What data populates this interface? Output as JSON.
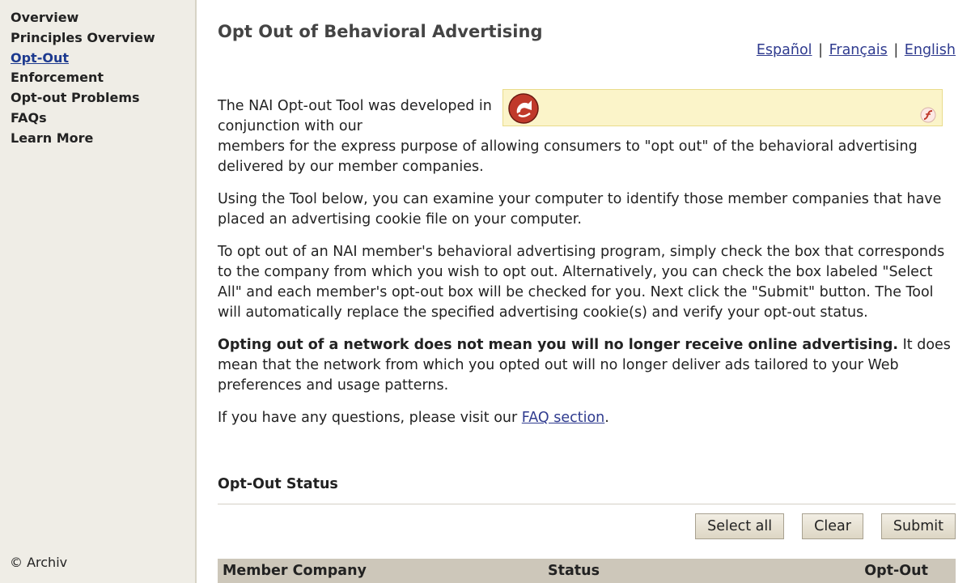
{
  "sidebar": {
    "items": [
      {
        "label": "Overview",
        "active": false
      },
      {
        "label": "Principles Overview",
        "active": false
      },
      {
        "label": "Opt-Out",
        "active": true
      },
      {
        "label": "Enforcement",
        "active": false
      },
      {
        "label": "Opt-out Problems",
        "active": false
      },
      {
        "label": "FAQs",
        "active": false
      },
      {
        "label": "Learn More",
        "active": false
      }
    ],
    "copyright": "© Archiv"
  },
  "main": {
    "title": "Opt Out of Behavioral Advertising",
    "languages": [
      "Español",
      "Français",
      "English"
    ],
    "separator": "|",
    "paragraphs": {
      "p1_start": "The NAI Opt-out Tool was developed in conjunction with our",
      "p1_rest": "members for the express purpose of allowing consumers to \"opt out\" of the behavioral advertising delivered by our member companies.",
      "p2": "Using the Tool below, you can examine your computer to identify those member companies that have placed an advertising cookie file on your computer.",
      "p3": "To opt out of an NAI member's behavioral advertising program, simply check the box that corresponds to the company from which you wish to opt out. Alternatively, you can check the box labeled \"Select All\" and each member's opt-out box will be checked for you. Next click the \"Submit\" button. The Tool will automatically replace the specified advertising cookie(s) and verify your opt-out status.",
      "p4_bold": "Opting out of a network does not mean you will no longer receive online advertising.",
      "p4_rest": " It does mean that the network from which you opted out will no longer deliver ads tailored to your Web preferences and usage patterns.",
      "p5_start": "If you have any questions, please visit our ",
      "p5_link": "FAQ section",
      "p5_end": "."
    },
    "status_heading": "Opt-Out Status",
    "buttons": {
      "select_all": "Select all",
      "clear": "Clear",
      "submit": "Submit"
    },
    "table": {
      "headers": [
        "Member Company",
        "Status",
        "Opt-Out"
      ]
    }
  },
  "colors": {
    "sidebar_bg": "#efede6",
    "link": "#2f3b8f",
    "active_nav": "#1d3a8f",
    "flash_bg": "#fbf4c9",
    "table_header_bg": "#cdc7ba"
  },
  "icons": {
    "flash_logo": "speaker-logo-icon",
    "flash_player": "flash-icon"
  }
}
